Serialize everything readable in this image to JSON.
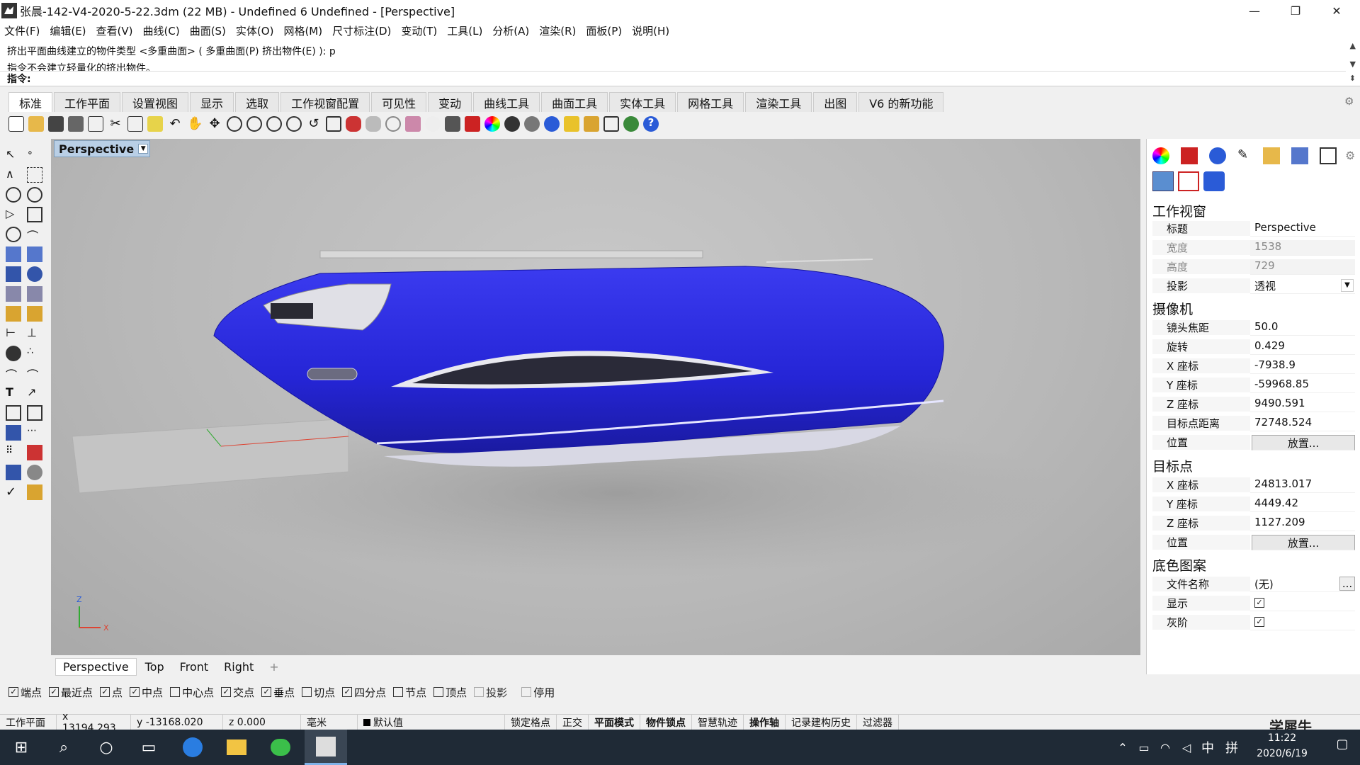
{
  "window": {
    "title": "张晨-142-V4-2020-5-22.3dm (22 MB) - Undefined 6 Undefined - [Perspective]"
  },
  "menu": [
    "文件(F)",
    "编辑(E)",
    "查看(V)",
    "曲线(C)",
    "曲面(S)",
    "实体(O)",
    "网格(M)",
    "尺寸标注(D)",
    "变动(T)",
    "工具(L)",
    "分析(A)",
    "渲染(R)",
    "面板(P)",
    "说明(H)"
  ],
  "command": {
    "history1": "挤出平面曲线建立的物件类型 <多重曲面> ( 多重曲面(P)  挤出物件(E) ): p",
    "history2": "指令不会建立轻量化的挤出物件。",
    "prompt": "指令:"
  },
  "tabs": [
    "标准",
    "工作平面",
    "设置视图",
    "显示",
    "选取",
    "工作视窗配置",
    "可见性",
    "变动",
    "曲线工具",
    "曲面工具",
    "实体工具",
    "网格工具",
    "渲染工具",
    "出图",
    "V6 的新功能"
  ],
  "viewport": {
    "label": "Perspective"
  },
  "viewport_tabs": [
    "Perspective",
    "Top",
    "Front",
    "Right",
    "+"
  ],
  "panel": {
    "sec_viewport": "工作视窗",
    "title_k": "标题",
    "title_v": "Perspective",
    "width_k": "宽度",
    "width_v": "1538",
    "height_k": "高度",
    "height_v": "729",
    "proj_k": "投影",
    "proj_v": "透视",
    "sec_camera": "摄像机",
    "lens_k": "镜头焦距",
    "lens_v": "50.0",
    "rot_k": "旋转",
    "rot_v": "0.429",
    "cx_k": "X 座标",
    "cx_v": "-7938.9",
    "cy_k": "Y 座标",
    "cy_v": "-59968.85",
    "cz_k": "Z 座标",
    "cz_v": "9490.591",
    "dist_k": "目标点距离",
    "dist_v": "72748.524",
    "pos_k": "位置",
    "place": "放置...",
    "sec_target": "目标点",
    "tx_k": "X 座标",
    "tx_v": "24813.017",
    "ty_k": "Y 座标",
    "ty_v": "4449.42",
    "tz_k": "Z 座标",
    "tz_v": "1127.209",
    "tpos_k": "位置",
    "sec_bg": "底色图案",
    "file_k": "文件名称",
    "file_v": "(无)",
    "browse": "...",
    "show_k": "显示",
    "gray_k": "灰阶"
  },
  "osnap": [
    {
      "label": "端点",
      "checked": true
    },
    {
      "label": "最近点",
      "checked": true
    },
    {
      "label": "点",
      "checked": true
    },
    {
      "label": "中点",
      "checked": true
    },
    {
      "label": "中心点",
      "checked": false
    },
    {
      "label": "交点",
      "checked": true
    },
    {
      "label": "垂点",
      "checked": true
    },
    {
      "label": "切点",
      "checked": false
    },
    {
      "label": "四分点",
      "checked": true
    },
    {
      "label": "节点",
      "checked": false
    },
    {
      "label": "顶点",
      "checked": false
    },
    {
      "label": "投影",
      "checked": false
    },
    {
      "label": "停用",
      "checked": false
    }
  ],
  "status": {
    "cplane": "工作平面",
    "x": "x 13194.293",
    "y": "y -13168.020",
    "z": "z 0.000",
    "unit": "毫米",
    "layer": "默认值",
    "grid": "锁定格点",
    "ortho": "正交",
    "planar": "平面模式",
    "osnap": "物件锁点",
    "smart": "智慧轨迹",
    "gumball": "操作轴",
    "history": "记录建构历史",
    "filter": "过滤器"
  },
  "taskbar": {
    "time": "11:22",
    "date": "2020/6/19",
    "ime": "中",
    "layout": "拼"
  },
  "watermark": "学犀牛"
}
